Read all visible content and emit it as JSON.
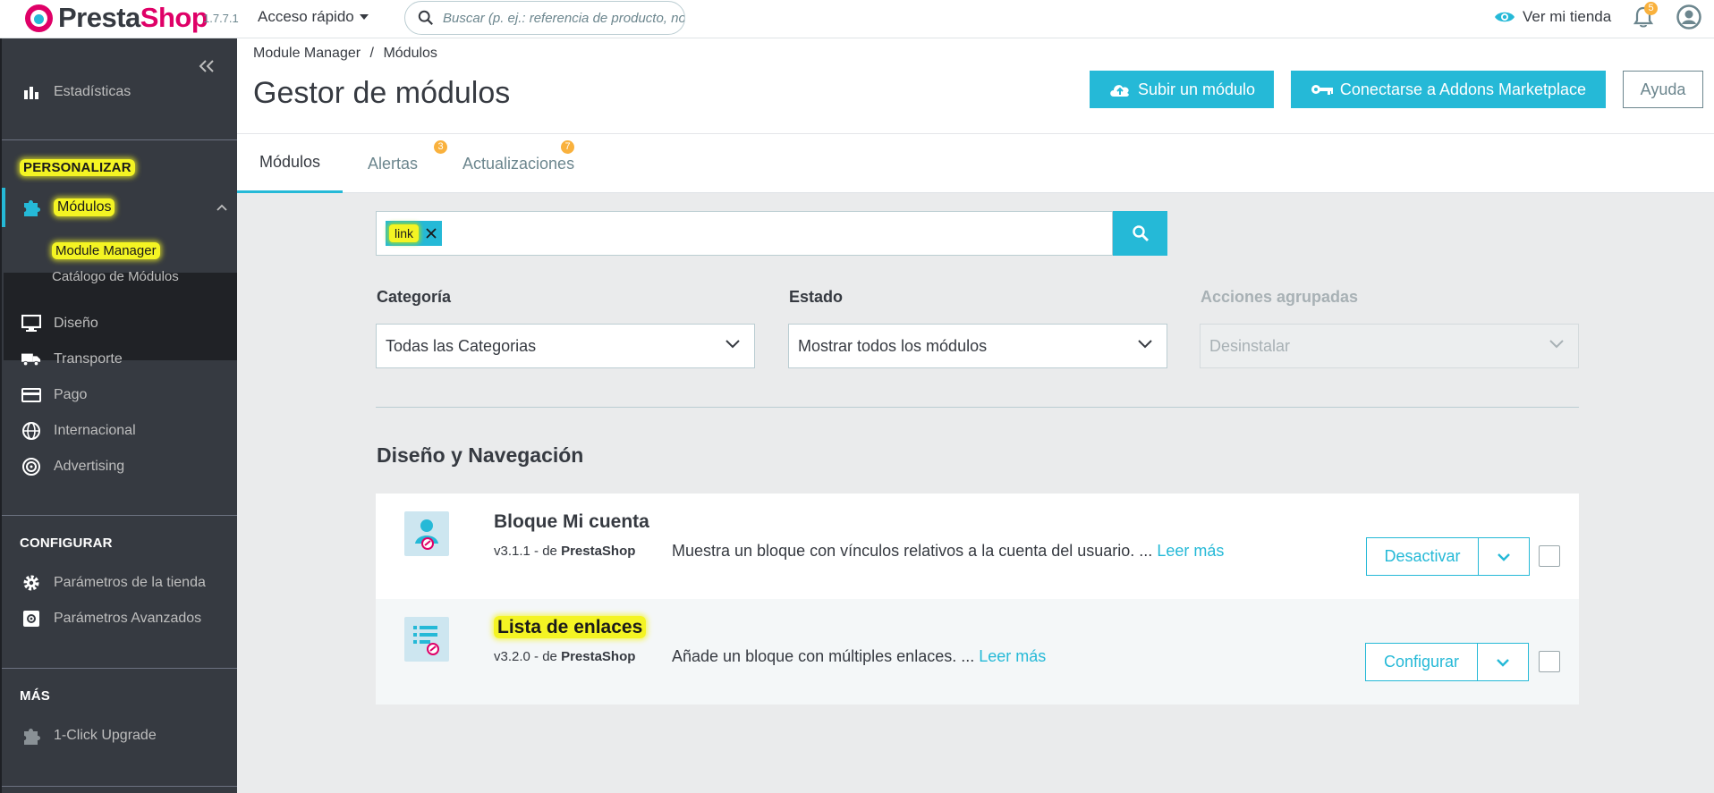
{
  "app": {
    "brand_part1": "Presta",
    "brand_part2": "Shop",
    "version": "1.7.7.1",
    "quick_access": "Acceso rápido",
    "search_placeholder": "Buscar (p. ej.: referencia de producto, no",
    "view_shop": "Ver mi tienda",
    "notification_count": "5"
  },
  "sidebar": {
    "stats_item": "Estadísticas",
    "section_customize": "PERSONALIZAR",
    "modules": "Módulos",
    "module_manager": "Module Manager",
    "module_catalog": "Catálogo de Módulos",
    "design": "Diseño",
    "shipping": "Transporte",
    "payment": "Pago",
    "international": "Internacional",
    "advertising": "Advertising",
    "section_configure": "CONFIGURAR",
    "shop_params": "Parámetros de la tienda",
    "advanced_params": "Parámetros Avanzados",
    "section_more": "MÁS",
    "upgrade": "1-Click Upgrade"
  },
  "header": {
    "breadcrumb_parent": "Module Manager",
    "breadcrumb_sep": "/",
    "breadcrumb_current": "Módulos",
    "title": "Gestor de módulos",
    "upload_btn": "Subir un módulo",
    "addons_btn": "Conectarse a Addons Marketplace",
    "help_btn": "Ayuda"
  },
  "tabs": [
    {
      "label": "Módulos",
      "badge": ""
    },
    {
      "label": "Alertas",
      "badge": "3"
    },
    {
      "label": "Actualizaciones",
      "badge": "7"
    }
  ],
  "filters": {
    "search_chip": "link",
    "category_label": "Categoría",
    "category_value": "Todas las Categorias",
    "status_label": "Estado",
    "status_value": "Mostrar todos los módulos",
    "bulk_label": "Acciones agrupadas",
    "bulk_value": "Desinstalar"
  },
  "section": {
    "title": "Diseño y Navegación"
  },
  "modules": [
    {
      "name": "Bloque Mi cuenta",
      "version": "v3.1.1 - de",
      "author": "PrestaShop",
      "description": "Muestra un bloque con vínculos relativos a la cuenta del usuario. ...",
      "read_more": "Leer más",
      "action": "Desactivar"
    },
    {
      "name": "Lista de enlaces",
      "version": "v3.2.0 - de",
      "author": "PrestaShop",
      "description": "Añade un bloque con múltiples enlaces. ...",
      "read_more": "Leer más",
      "action": "Configurar"
    }
  ],
  "colors": {
    "accent": "#25b9d7",
    "brand": "#df0067",
    "sidebar": "#363a41",
    "highlight": "#f4f423",
    "badge": "#f9b13d"
  }
}
